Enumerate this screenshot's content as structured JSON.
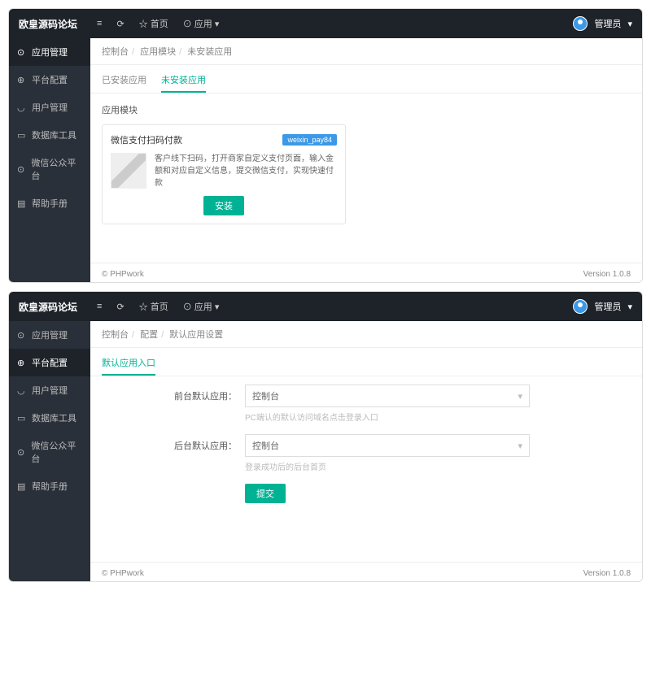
{
  "brand": "欧皇源码论坛",
  "topActions": {
    "toggle": "≡",
    "refresh": "⟳",
    "home": "首页",
    "app": "应用"
  },
  "user": {
    "name": "管理员",
    "chev": "▾"
  },
  "sidebar": {
    "items": [
      {
        "label": "应用管理"
      },
      {
        "label": "平台配置"
      },
      {
        "label": "用户管理"
      },
      {
        "label": "数据库工具"
      },
      {
        "label": "微信公众平台"
      },
      {
        "label": "帮助手册"
      }
    ]
  },
  "screen1": {
    "breadcrumb": [
      "控制台",
      "应用模块",
      "未安装应用"
    ],
    "tabs": [
      "已安装应用",
      "未安装应用"
    ],
    "sectionTitle": "应用模块",
    "card": {
      "title": "微信支付扫码付款",
      "badge": "weixin_pay84",
      "desc": "客户线下扫码，打开商家自定义支付页面，输入金额和对应自定义信息，提交微信支付，实现快速付款",
      "installBtn": "安装"
    }
  },
  "screen2": {
    "breadcrumb": [
      "控制台",
      "配置",
      "默认应用设置"
    ],
    "tabs": [
      "默认应用入口"
    ],
    "form": {
      "field1": {
        "label": "前台默认应用：",
        "value": "控制台",
        "hint": "PC端认的默认访问域名点击登录入口"
      },
      "field2": {
        "label": "后台默认应用：",
        "value": "控制台",
        "hint": "登录成功后的后台首页"
      },
      "submit": "提交"
    }
  },
  "footer": {
    "left": "© PHPwork",
    "right": "Version 1.0.8"
  }
}
